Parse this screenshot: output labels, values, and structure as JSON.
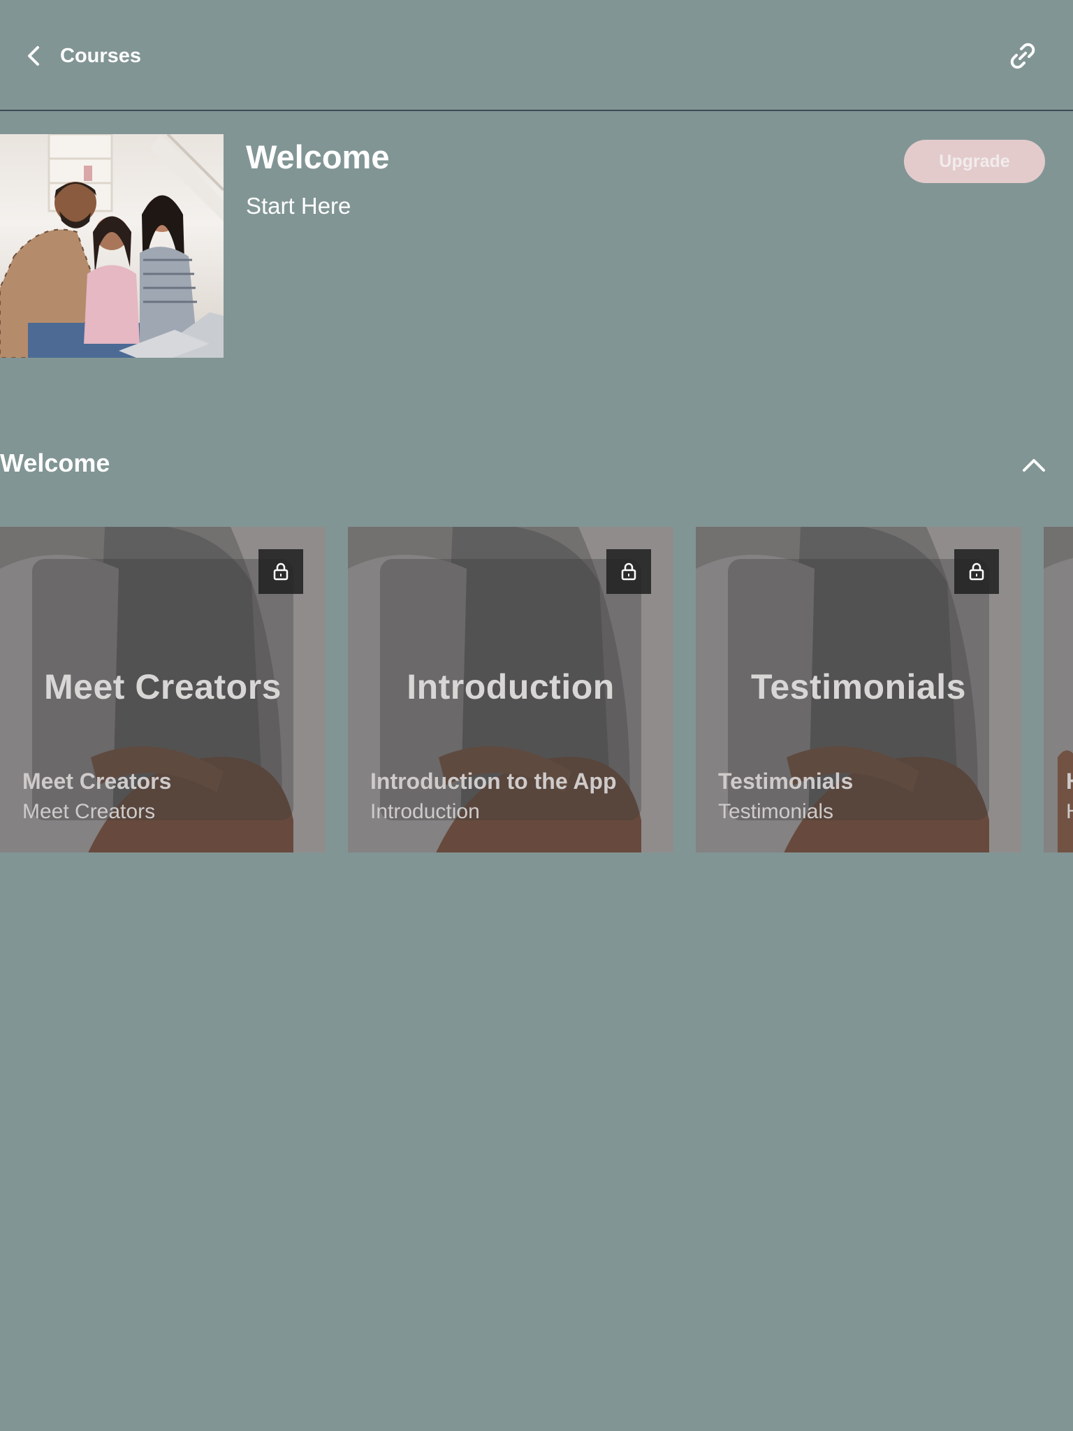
{
  "header": {
    "back_label": "Courses",
    "icons": {
      "back": "chevron-left-icon",
      "share": "link-icon"
    }
  },
  "course": {
    "title": "Welcome",
    "subtitle": "Start Here",
    "upgrade_label": "Upgrade"
  },
  "section": {
    "title": "Welcome",
    "collapse_icon": "chevron-up-icon"
  },
  "cards": [
    {
      "cover_text": "Meet Creators",
      "title": "Meet Creators",
      "subtitle": "Meet Creators",
      "locked": true
    },
    {
      "cover_text": "Introduction",
      "title": "Introduction to the App",
      "subtitle": "Introduction",
      "locked": true
    },
    {
      "cover_text": "Testimonials",
      "title": "Testimonials",
      "subtitle": "Testimonials",
      "locked": true
    },
    {
      "cover_text": "",
      "title": "H",
      "subtitle": "H",
      "locked": true
    }
  ],
  "colors": {
    "background": "#819594",
    "upgrade_button": "#e3cbcc",
    "divider": "#3c4a58"
  }
}
